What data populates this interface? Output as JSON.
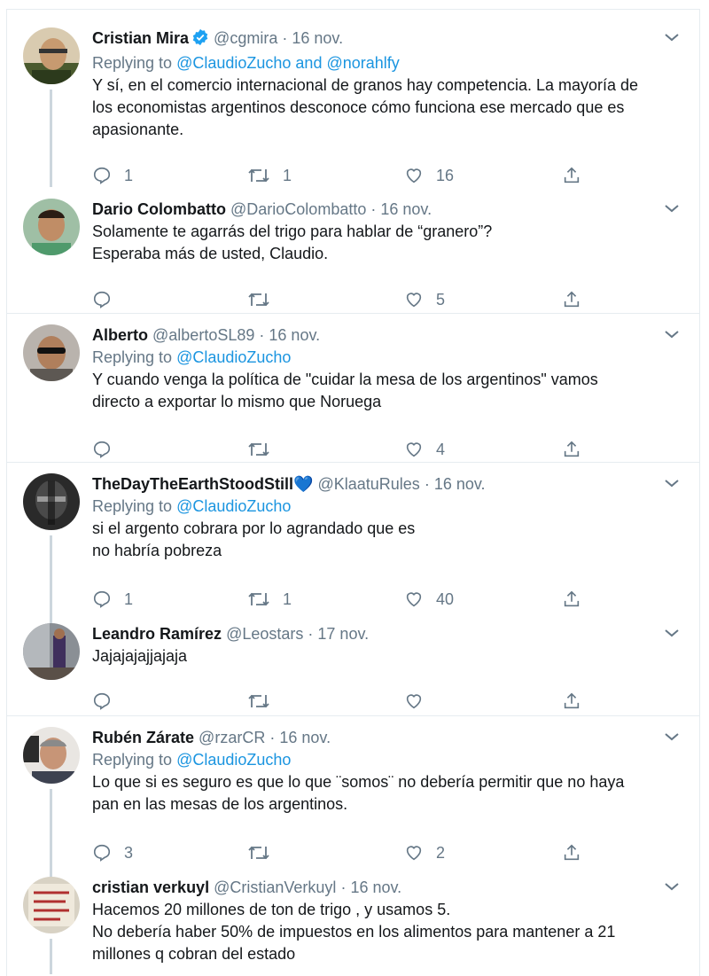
{
  "tweets": [
    {
      "name": "Cristian Mira",
      "verified": true,
      "handle": "@cgmira",
      "date": "16 nov.",
      "replying_prefix": "Replying to",
      "replying_to": "@ClaudioZucho and @norahlfy",
      "lines": [
        "Y sí, en el comercio internacional de granos hay competencia. La mayoría de",
        "los economistas argentinos desconoce cómo funciona ese mercado que es",
        "apasionante."
      ],
      "reply_count": "1",
      "retweet_count": "1",
      "like_count": "16"
    },
    {
      "name": "Dario Colombatto",
      "verified": false,
      "handle": "@DarioColombatto",
      "date": "16 nov.",
      "replying_prefix": "",
      "replying_to": "",
      "lines": [
        "Solamente te agarrás del trigo para hablar de “granero”?",
        "Esperaba más de usted, Claudio."
      ],
      "reply_count": "",
      "retweet_count": "",
      "like_count": "5"
    },
    {
      "name": "Alberto",
      "verified": false,
      "handle": "@albertoSL89",
      "date": "16 nov.",
      "replying_prefix": "Replying to",
      "replying_to": "@ClaudioZucho",
      "lines": [
        "Y cuando venga la política de \"cuidar la mesa de los argentinos\" vamos",
        "directo a exportar lo mismo que Noruega"
      ],
      "reply_count": "",
      "retweet_count": "",
      "like_count": "4"
    },
    {
      "name": "TheDayTheEarthStoodStill",
      "name_emoji": "💙",
      "verified": false,
      "handle": "@KlaatuRules",
      "date": "16 nov.",
      "replying_prefix": "Replying to",
      "replying_to": "@ClaudioZucho",
      "lines": [
        "si el argento cobrara por lo agrandado que es",
        "no habría pobreza"
      ],
      "reply_count": "1",
      "retweet_count": "1",
      "like_count": "40"
    },
    {
      "name": "Leandro Ramírez",
      "verified": false,
      "handle": "@Leostars",
      "date": "17 nov.",
      "replying_prefix": "",
      "replying_to": "",
      "lines": [
        "Jajajajajjajaja"
      ],
      "reply_count": "",
      "retweet_count": "",
      "like_count": ""
    },
    {
      "name": "Rubén Zárate",
      "verified": false,
      "handle": "@rzarCR",
      "date": "16 nov.",
      "replying_prefix": "Replying to",
      "replying_to": "@ClaudioZucho",
      "lines": [
        "Lo que si es seguro es que lo que ¨somos¨ no debería permitir que no haya",
        "pan en las mesas de los argentinos."
      ],
      "reply_count": "3",
      "retweet_count": "",
      "like_count": "2"
    },
    {
      "name": "cristian verkuyl",
      "verified": false,
      "handle": "@CristianVerkuyl",
      "date": "16 nov.",
      "replying_prefix": "",
      "replying_to": "",
      "lines": [
        "Hacemos 20 millones de ton de trigo , y usamos 5.",
        "No debería haber 50% de impuestos en los alimentos para mantener a 21",
        "millones q cobran del estado"
      ],
      "reply_count": "",
      "retweet_count": "",
      "like_count": ""
    }
  ],
  "colors": {
    "accent": "#1b95e0",
    "muted": "#657786",
    "text": "#14171a",
    "border": "#e6ecf0",
    "verified": "#1da1f2"
  }
}
